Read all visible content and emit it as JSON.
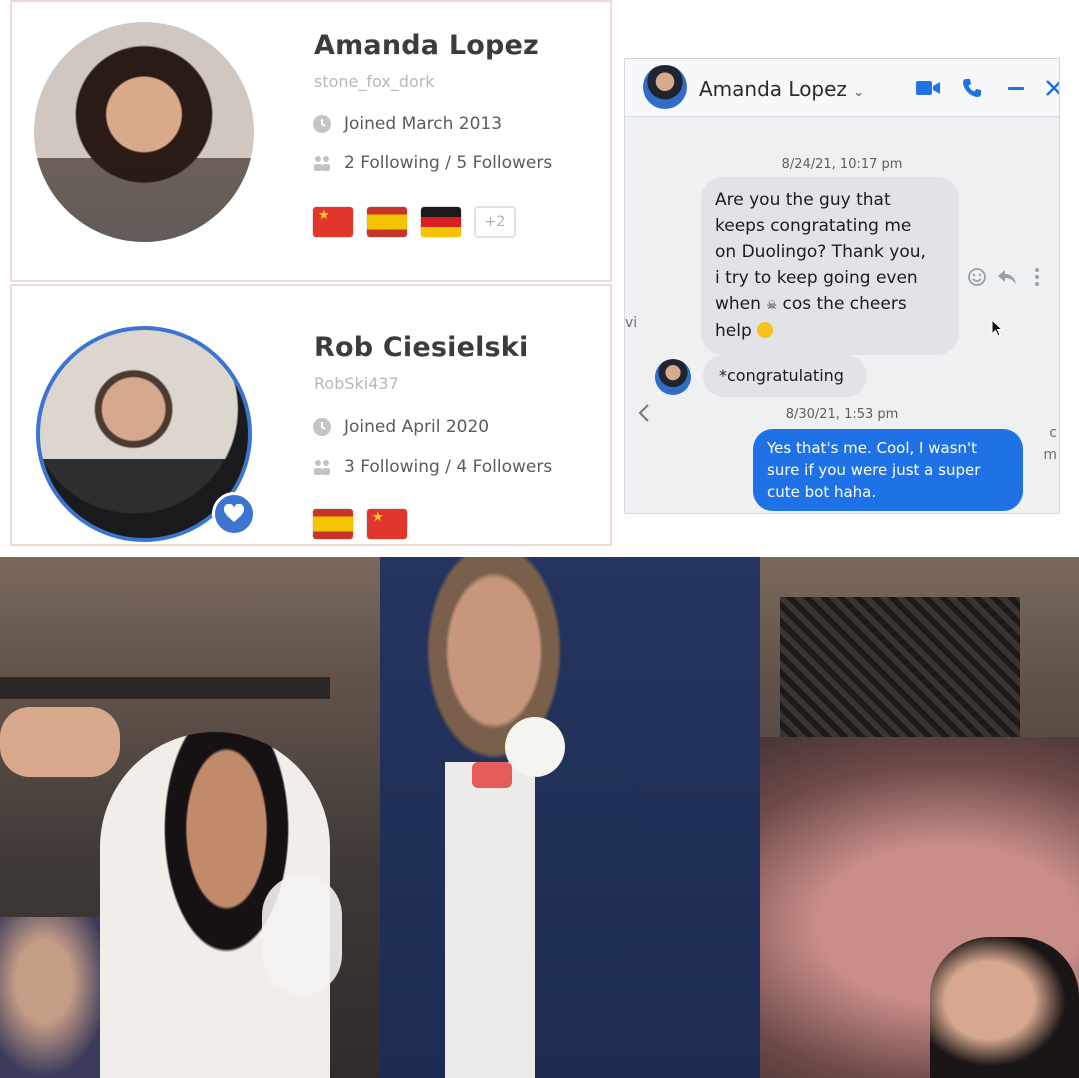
{
  "profiles": [
    {
      "name": "Amanda Lopez",
      "handle": "stone_fox_dork",
      "joined": "Joined March 2013",
      "follow": "2 Following / 5 Followers",
      "flags": [
        "china-flag",
        "spain-flag",
        "germany-flag"
      ],
      "more_flags": "+2"
    },
    {
      "name": "Rob Ciesielski",
      "handle": "RobSki437",
      "joined": "Joined April 2020",
      "follow": "3 Following / 4 Followers",
      "flags": [
        "spain-flag",
        "china-flag"
      ],
      "badge_icon": "heart-icon"
    }
  ],
  "messenger": {
    "contact_name": "Amanda Lopez",
    "header_icons": [
      "video-call-icon",
      "phone-icon",
      "minimize-icon",
      "close-icon"
    ],
    "accent_color": "#1f72e6",
    "messages": [
      {
        "timestamp": "8/24/21, 10:17 pm"
      },
      {
        "from": "Amanda Lopez",
        "lines": [
          "Are you the guy that",
          "keeps congratating me",
          "on Duolingo? Thank you,",
          "i try to keep going even",
          "when",
          "cos the cheers",
          "help"
        ]
      },
      {
        "from": "Amanda Lopez",
        "text": "*congratulating"
      },
      {
        "timestamp": "8/30/21, 1:53 pm"
      },
      {
        "from": "me",
        "lines": [
          "Yes that's me. Cool, I wasn't",
          "sure if you were just a super",
          "cute bot haha."
        ]
      }
    ],
    "edge_left": "vi",
    "edge_right_1": "c",
    "edge_right_2": "m"
  },
  "photo": {
    "subject": "wedding-photo"
  }
}
